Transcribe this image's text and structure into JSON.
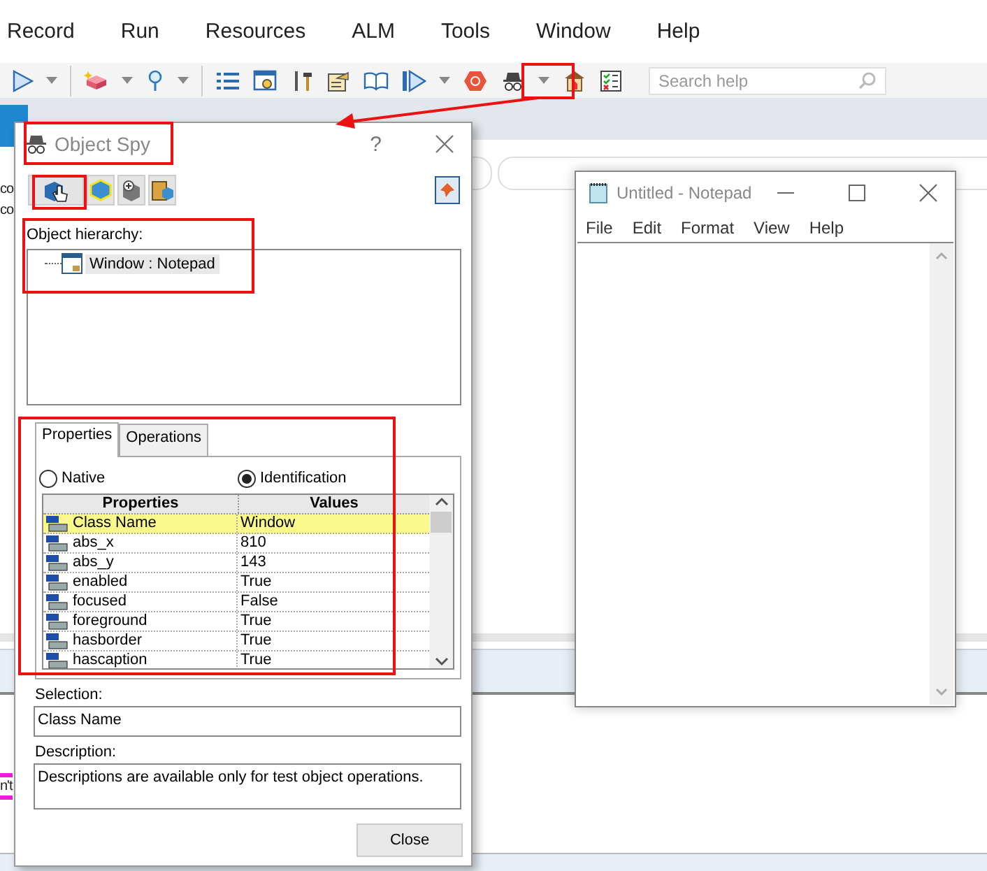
{
  "menu_bar": [
    "Record",
    "Run",
    "Resources",
    "ALM",
    "Tools",
    "Window",
    "Help"
  ],
  "toolbar": {
    "search": {
      "placeholder": "Search help"
    }
  },
  "background_fragments": [
    "co",
    "co",
    "n't"
  ],
  "object_spy": {
    "title": "Object Spy",
    "help": "?",
    "hierarchy_label": "Object hierarchy:",
    "tree": [
      {
        "label": "Window :  Notepad",
        "selected": true
      }
    ],
    "tabs": [
      {
        "label": "Properties",
        "selected": true
      },
      {
        "label": "Operations",
        "selected": false
      }
    ],
    "radios": [
      {
        "label": "Native",
        "selected": false
      },
      {
        "label": "Identification",
        "selected": true
      }
    ],
    "columns": [
      "Properties",
      "Values"
    ],
    "rows": [
      {
        "property": "Class Name",
        "value": "Window",
        "selected": true
      },
      {
        "property": "abs_x",
        "value": "810",
        "selected": false
      },
      {
        "property": "abs_y",
        "value": "143",
        "selected": false
      },
      {
        "property": "enabled",
        "value": "True",
        "selected": false
      },
      {
        "property": "focused",
        "value": "False",
        "selected": false
      },
      {
        "property": "foreground",
        "value": "True",
        "selected": false
      },
      {
        "property": "hasborder",
        "value": "True",
        "selected": false
      },
      {
        "property": "hascaption",
        "value": "True",
        "selected": false
      }
    ],
    "selection_label": "Selection:",
    "selection_value": "Class Name",
    "description_label": "Description:",
    "description_value": "Descriptions are available only for test object operations.",
    "close_button": "Close"
  },
  "notepad": {
    "title": "Untitled - Notepad",
    "menu": [
      "File",
      "Edit",
      "Format",
      "View",
      "Help"
    ]
  }
}
